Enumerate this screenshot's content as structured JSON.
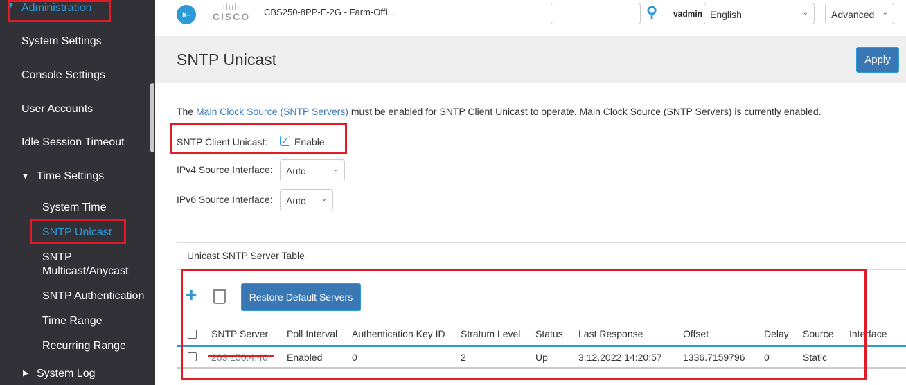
{
  "sidebar": {
    "items": [
      {
        "label": "Administration",
        "active": true
      },
      {
        "label": "System Settings"
      },
      {
        "label": "Console Settings"
      },
      {
        "label": "User Accounts"
      },
      {
        "label": "Idle Session Timeout"
      },
      {
        "label": "Time Settings",
        "expanded": true
      },
      {
        "label": "System Time"
      },
      {
        "label": "SNTP Unicast",
        "active": true
      },
      {
        "label": "SNTP Multicast/Anycast"
      },
      {
        "label": "SNTP Authentication"
      },
      {
        "label": "Time Range"
      },
      {
        "label": "Recurring Range"
      },
      {
        "label": "System Log"
      }
    ]
  },
  "header": {
    "logo": "CISCO",
    "device": "CBS250-8PP-E-2G - Farm-Offi...",
    "search_value": "",
    "user": "vadmin",
    "language": "English",
    "mode": "Advanced"
  },
  "page": {
    "title": "SNTP Unicast",
    "apply": "Apply",
    "info_prefix": "The ",
    "info_link": "Main Clock Source (SNTP Servers)",
    "info_suffix": " must be enabled for SNTP Client Unicast to operate. Main Clock Source (SNTP Servers) is currently enabled.",
    "client_label": "SNTP Client Unicast:",
    "client_enable": "Enable",
    "client_checked": true,
    "ipv4_label": "IPv4 Source Interface:",
    "ipv4_value": "Auto",
    "ipv6_label": "IPv6 Source Interface:",
    "ipv6_value": "Auto"
  },
  "table": {
    "title": "Unicast SNTP Server Table",
    "restore": "Restore Default Servers",
    "columns": [
      "SNTP Server",
      "Poll Interval",
      "Authentication Key ID",
      "Stratum Level",
      "Status",
      "Last Response",
      "Offset",
      "Delay",
      "Source",
      "Interface"
    ],
    "rows": [
      [
        "203.150.4.40",
        "Enabled",
        "0",
        "2",
        "Up",
        "3.12.2022 14:20:57",
        "1336.7159796",
        "0",
        "Static",
        ""
      ]
    ]
  },
  "colors": {
    "accent": "#2c9ad9",
    "button": "#3a78b5",
    "sidebar": "#323137",
    "annotation": "#e21c24"
  }
}
